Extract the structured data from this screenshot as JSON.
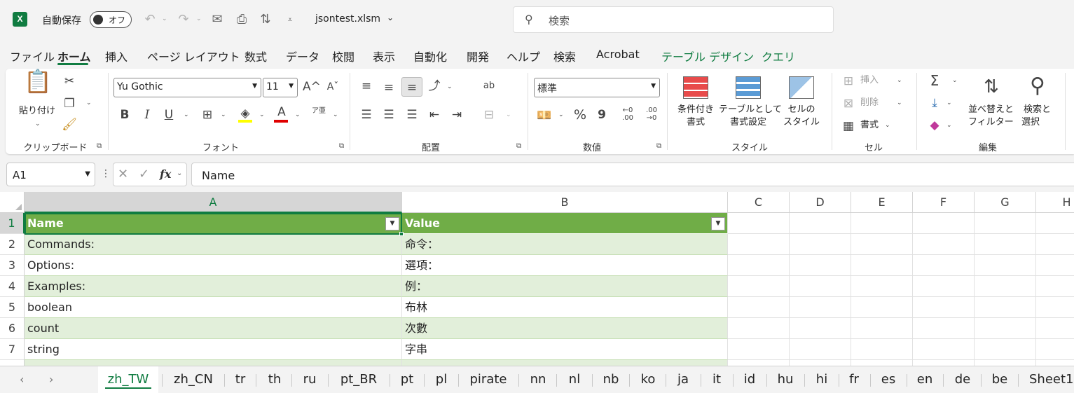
{
  "titlebar": {
    "app_icon": "X",
    "autosave_label": "自動保存",
    "autosave_state": "オフ",
    "file_name": "jsontest.xlsm",
    "search_placeholder": "検索"
  },
  "menu": {
    "tabs": [
      "ファイル",
      "ホーム",
      "挿入",
      "ページ レイアウト",
      "数式",
      "データ",
      "校閲",
      "表示",
      "自動化",
      "開発",
      "ヘルプ",
      "検索",
      "Acrobat",
      "テーブル デザイン",
      "クエリ"
    ],
    "active": "ホーム",
    "contextual_color": "#107c41"
  },
  "ribbon": {
    "clipboard": {
      "paste_label": "貼り付け",
      "group_label": "クリップボード"
    },
    "font": {
      "font_name": "Yu Gothic",
      "font_size": "11",
      "bold": "B",
      "italic": "I",
      "underline": "U",
      "font_color_glyph": "A",
      "phonetic_glyph": "ア亜",
      "grow_glyph": "A^",
      "shrink_glyph": "Aˇ",
      "group_label": "フォント",
      "highlight_color": "#ffff00",
      "font_color": "#e00000"
    },
    "alignment": {
      "wrap_glyph": "ab",
      "group_label": "配置"
    },
    "number": {
      "format": "標準",
      "percent": "%",
      "comma": "9",
      "inc_decimal": "←0 .00",
      "dec_decimal": ".00 →0",
      "group_label": "数値"
    },
    "styles": {
      "conditional_line1": "条件付き",
      "conditional_line2": "書式",
      "table_line1": "テーブルとして",
      "table_line2": "書式設定",
      "cell_line1": "セルの",
      "cell_line2": "スタイル",
      "group_label": "スタイル"
    },
    "cells": {
      "insert": "挿入",
      "delete": "削除",
      "format": "書式",
      "group_label": "セル"
    },
    "editing": {
      "sort_line1": "並べ替えと",
      "sort_line2": "フィルター",
      "find_line1": "検索と",
      "find_line2": "選択",
      "sigma": "Σ",
      "group_label": "編集"
    }
  },
  "formula_bar": {
    "name_box": "A1",
    "fx": "fx",
    "content": "Name"
  },
  "sheet": {
    "columns": [
      "A",
      "B",
      "C",
      "D",
      "E",
      "F",
      "G",
      "H"
    ],
    "selected_column": "A",
    "rows": [
      "1",
      "2",
      "3",
      "4",
      "5",
      "6",
      "7"
    ],
    "selected_row": "1",
    "table_header": {
      "name": "Name",
      "value": "Value"
    },
    "table_rows": [
      {
        "name": "Commands:",
        "value": "命令："
      },
      {
        "name": "Options:",
        "value": "選項："
      },
      {
        "name": "Examples:",
        "value": "例："
      },
      {
        "name": "boolean",
        "value": "布林"
      },
      {
        "name": "count",
        "value": "次數"
      },
      {
        "name": "string",
        "value": "字串"
      }
    ],
    "header_color": "#70ad47",
    "band_color": "#e2efda"
  },
  "sheet_tabs": {
    "tabs": [
      "zh_TW",
      "zh_CN",
      "tr",
      "th",
      "ru",
      "pt_BR",
      "pt",
      "pl",
      "pirate",
      "nn",
      "nl",
      "nb",
      "ko",
      "ja",
      "it",
      "id",
      "hu",
      "hi",
      "fr",
      "es",
      "en",
      "de",
      "be",
      "Sheet1"
    ],
    "active": "zh_TW"
  }
}
